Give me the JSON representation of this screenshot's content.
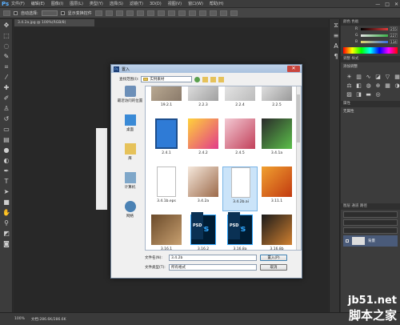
{
  "app": {
    "logo": "Ps",
    "menu": [
      "文件(F)",
      "编辑(E)",
      "图像(I)",
      "图层(L)",
      "类型(Y)",
      "选择(S)",
      "滤镜(T)",
      "3D(D)",
      "视图(V)",
      "窗口(W)",
      "帮助(H)"
    ],
    "window_controls": [
      "—",
      "□",
      "✕"
    ]
  },
  "options_bar": {
    "auto_select_label": "自动选择:",
    "show_transform_label": "显示变换控件"
  },
  "doc_tab": "3.4.2a.jpg @ 100%(RGB/8)",
  "status": {
    "zoom": "100%",
    "doc_info": "文档:286.6K/286.6K"
  },
  "panels": {
    "color_header": "颜色  色板",
    "rgb": [
      {
        "label": "R",
        "value": "255",
        "color": "#e23b3b"
      },
      {
        "label": "G",
        "value": "227",
        "color": "#3bb24a"
      },
      {
        "label": "B",
        "value": "134",
        "color": "#3b6ee2"
      }
    ],
    "adjust_header": "调整  样式",
    "adjust_sub": "添加调整",
    "props_header": "属性",
    "props_sub": "无属性",
    "layers_header": "图层  通道  路径",
    "layer_name": "背景"
  },
  "dialog": {
    "title": "置入",
    "lookin_label": "查找范围(I):",
    "lookin_value": "实例素材",
    "places": [
      {
        "label": "最近访问的位置",
        "icon": "recent-places-icon"
      },
      {
        "label": "桌面",
        "icon": "desktop-icon"
      },
      {
        "label": "库",
        "icon": "libraries-icon"
      },
      {
        "label": "计算机",
        "icon": "computer-icon"
      },
      {
        "label": "网络",
        "icon": "network-icon"
      }
    ],
    "files": [
      {
        "name": "19.2.1",
        "kind": "image",
        "colors": [
          "#c9b9a0",
          "#8a7a6a"
        ]
      },
      {
        "name": "2.2.3",
        "kind": "image",
        "colors": [
          "#f2f2f2",
          "#a0a0a0"
        ]
      },
      {
        "name": "2.2.4",
        "kind": "image",
        "colors": [
          "#f2f2f2",
          "#bbbbbb"
        ]
      },
      {
        "name": "2.2.5",
        "kind": "image",
        "colors": [
          "#f7f7f7",
          "#999999"
        ]
      },
      {
        "name": "2.4.1",
        "kind": "floppy",
        "colors": [
          "#2f7bd6",
          "#1c4d8c"
        ]
      },
      {
        "name": "2.4.2",
        "kind": "image",
        "colors": [
          "#ffd23a",
          "#e23b8a"
        ]
      },
      {
        "name": "2.4.5",
        "kind": "image",
        "colors": [
          "#f3c9d3",
          "#c2405a"
        ]
      },
      {
        "name": "3.4.1a",
        "kind": "image",
        "colors": [
          "#2a2a2a",
          "#5bc04a"
        ]
      },
      {
        "name": "3.4.1b.eps",
        "kind": "doc",
        "colors": [
          "#ffffff",
          "#bdbdbd"
        ]
      },
      {
        "name": "3.4.2a",
        "kind": "image",
        "colors": [
          "#f5e8dc",
          "#9c6a4a"
        ]
      },
      {
        "name": "3.4.2b.ai",
        "kind": "doc",
        "colors": [
          "#ffffff",
          "#bdbdbd"
        ],
        "selected": true
      },
      {
        "name": "3.11.1",
        "kind": "image",
        "colors": [
          "#f0a030",
          "#c23a10"
        ]
      },
      {
        "name": "3.16.1",
        "kind": "image",
        "colors": [
          "#6a4a2a",
          "#c8a070"
        ]
      },
      {
        "name": "3.16.2",
        "kind": "psd",
        "colors": [
          "#001d34",
          "#31a8ff"
        ]
      },
      {
        "name": "3.16.8a",
        "kind": "psd",
        "colors": [
          "#001d34",
          "#31a8ff"
        ]
      },
      {
        "name": "3.16.8b",
        "kind": "image",
        "colors": [
          "#1a1a1a",
          "#d08030"
        ]
      }
    ],
    "psd_label": "Ps",
    "psd_badge": "PSD",
    "filename_label": "文件名(N):",
    "filename_value": "3.4.2b",
    "filetype_label": "文件类型(T):",
    "filetype_value": "所有格式",
    "place_button": "置入(P)",
    "cancel_button": "取消"
  },
  "watermark": {
    "site": "jb51.net",
    "cn": "脚本之家"
  }
}
